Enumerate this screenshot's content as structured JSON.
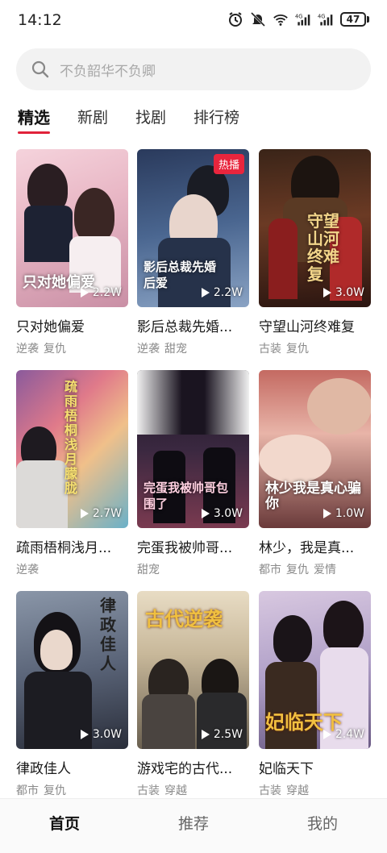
{
  "status": {
    "time": "14:12",
    "battery": "47",
    "icons": [
      "alarm-icon",
      "mute-icon",
      "wifi-6-icon",
      "4g-signal-icon",
      "4g-signal-icon",
      "battery-icon"
    ]
  },
  "search": {
    "placeholder": "不负韶华不负卿"
  },
  "tabs": [
    {
      "label": "精选",
      "active": true
    },
    {
      "label": "新剧",
      "active": false
    },
    {
      "label": "找剧",
      "active": false
    },
    {
      "label": "排行榜",
      "active": false
    }
  ],
  "cards": [
    {
      "title": "只对她偏爱",
      "tags": [
        "逆袭",
        "复仇"
      ],
      "poster_text": "只对她偏爱",
      "count": "2.2W",
      "badge": ""
    },
    {
      "title": "影后总裁先婚...",
      "tags": [
        "逆袭",
        "甜宠"
      ],
      "poster_text": "影后总裁先婚后爱",
      "count": "2.2W",
      "badge": "热播"
    },
    {
      "title": "守望山河终难复",
      "tags": [
        "古装",
        "复仇"
      ],
      "poster_text": "守望山河终难复",
      "count": "3.0W",
      "badge": ""
    },
    {
      "title": "疏雨梧桐浅月...",
      "tags": [
        "逆袭"
      ],
      "poster_text": "疏雨梧桐浅月朦胧",
      "count": "2.7W",
      "badge": ""
    },
    {
      "title": "完蛋我被帅哥...",
      "tags": [
        "甜宠"
      ],
      "poster_text": "完蛋我被帅哥包围了",
      "count": "3.0W",
      "badge": ""
    },
    {
      "title": "林少，我是真...",
      "tags": [
        "都市",
        "复仇",
        "爱情"
      ],
      "poster_text": "林少我是真心骗你",
      "count": "1.0W",
      "badge": ""
    },
    {
      "title": "律政佳人",
      "tags": [
        "都市",
        "复仇"
      ],
      "poster_text": "律政佳人",
      "count": "3.0W",
      "badge": ""
    },
    {
      "title": "游戏宅的古代...",
      "tags": [
        "古装",
        "穿越"
      ],
      "poster_text": "古代逆袭",
      "count": "2.5W",
      "badge": ""
    },
    {
      "title": "妃临天下",
      "tags": [
        "古装",
        "穿越"
      ],
      "poster_text": "妃临天下",
      "count": "2.4W",
      "badge": ""
    }
  ],
  "bottom_nav": [
    {
      "label": "首页",
      "active": true
    },
    {
      "label": "推荐",
      "active": false
    },
    {
      "label": "我的",
      "active": false
    }
  ],
  "colors": {
    "accent": "#e0223a",
    "hot_badge": "#e8253d"
  }
}
